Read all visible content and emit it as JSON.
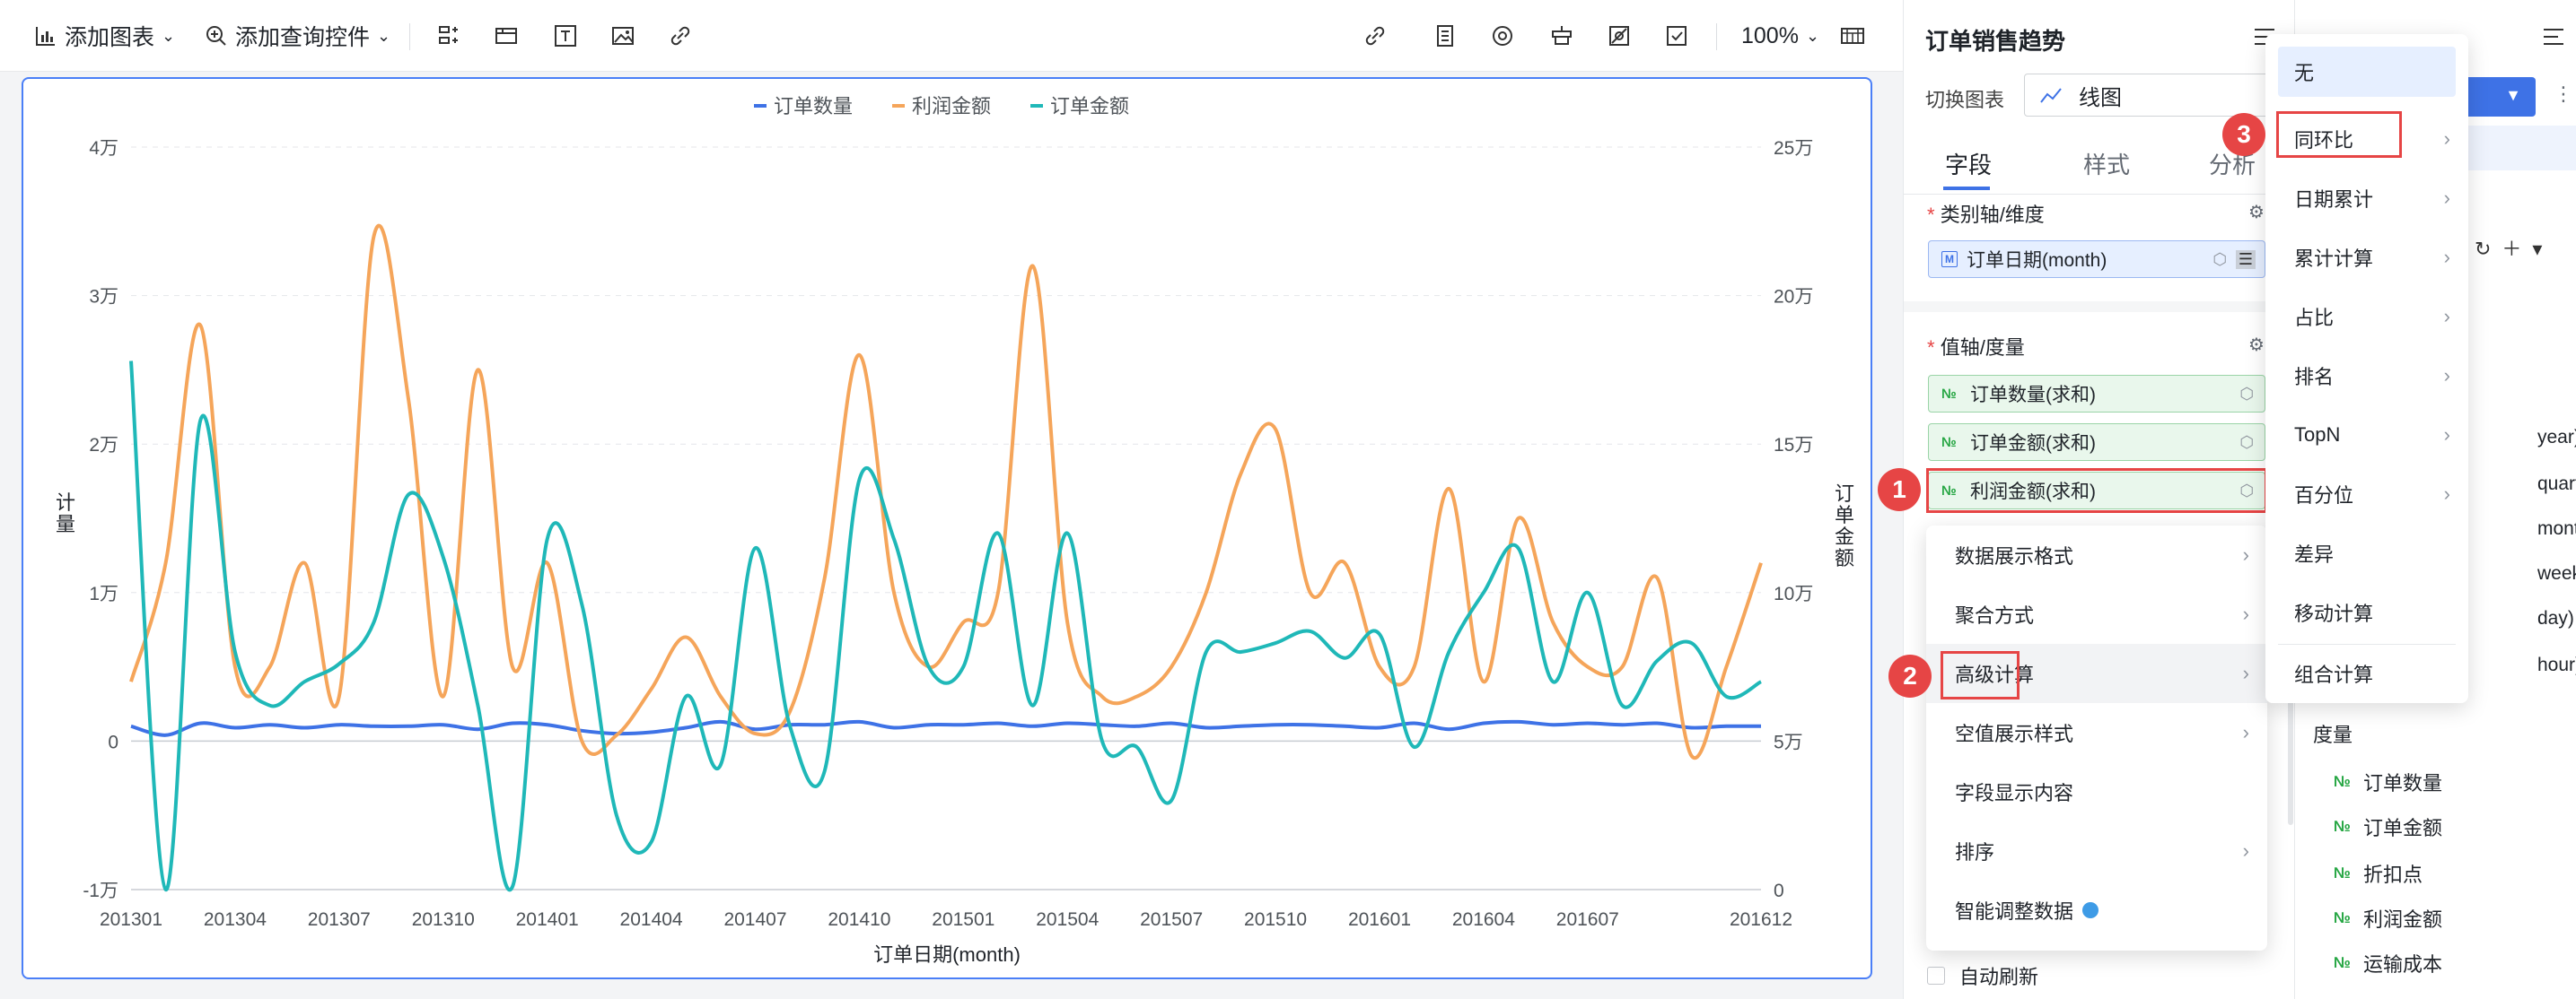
{
  "toolbar": {
    "add_chart": "添加图表",
    "add_control": "添加查询控件",
    "zoom": "100%"
  },
  "chart": {
    "legend": [
      "订单数量",
      "利润金额",
      "订单金额"
    ],
    "y_left_label": "计量",
    "y_right_label": "订单金额",
    "x_label": "订单日期(month)",
    "y_left_ticks": [
      "4万",
      "3万",
      "2万",
      "1万",
      "0",
      "-1万"
    ],
    "y_right_ticks": [
      "25万",
      "20万",
      "15万",
      "10万",
      "5万",
      "0"
    ],
    "x_ticks": [
      "201301",
      "201304",
      "201307",
      "201310",
      "201401",
      "201404",
      "201407",
      "201410",
      "201501",
      "201504",
      "201507",
      "201510",
      "201601",
      "201604",
      "201607",
      "201612"
    ]
  },
  "chart_data": {
    "type": "line",
    "x": [
      "201301",
      "201302",
      "201303",
      "201304",
      "201305",
      "201306",
      "201307",
      "201308",
      "201309",
      "201310",
      "201311",
      "201312",
      "201401",
      "201402",
      "201403",
      "201404",
      "201405",
      "201406",
      "201407",
      "201408",
      "201409",
      "201410",
      "201411",
      "201412",
      "201501",
      "201502",
      "201503",
      "201504",
      "201505",
      "201506",
      "201507",
      "201508",
      "201509",
      "201510",
      "201511",
      "201512",
      "201601",
      "201602",
      "201603",
      "201604",
      "201605",
      "201606",
      "201607",
      "201608",
      "201609",
      "201610",
      "201611",
      "201612"
    ],
    "series": [
      {
        "name": "订单数量",
        "axis": "left",
        "color": "#3e72e6",
        "values": [
          1000,
          400,
          1200,
          900,
          1100,
          900,
          1100,
          1000,
          1000,
          1100,
          800,
          1200,
          1100,
          700,
          500,
          600,
          900,
          1300,
          800,
          1100,
          1100,
          1300,
          900,
          1100,
          1100,
          1200,
          1000,
          1200,
          1100,
          1000,
          1200,
          900,
          1000,
          1100,
          1100,
          1000,
          900,
          1200,
          800,
          1200,
          1300,
          1100,
          1200,
          1100,
          1200,
          900,
          1000,
          1000
        ]
      },
      {
        "name": "利润金额",
        "axis": "left",
        "color": "#f5a55a",
        "values": [
          4000,
          12000,
          28000,
          5000,
          5000,
          12000,
          3000,
          34000,
          23000,
          3000,
          25000,
          5000,
          12000,
          0,
          400,
          3500,
          7000,
          3000,
          500,
          2000,
          11000,
          26000,
          10000,
          5000,
          8000,
          10000,
          32000,
          8000,
          3000,
          3000,
          5000,
          10000,
          18000,
          21000,
          10000,
          12000,
          5000,
          5000,
          17000,
          4000,
          15000,
          8000,
          5000,
          5000,
          11000,
          -1000,
          5000,
          12000
        ]
      },
      {
        "name": "订单金额",
        "axis": "right",
        "color": "#1fb8b8",
        "values": [
          178000,
          0,
          158000,
          80000,
          62000,
          70000,
          76000,
          90000,
          133000,
          112000,
          62000,
          1000,
          118000,
          96000,
          25000,
          16000,
          65000,
          42000,
          115000,
          55000,
          40000,
          138000,
          118000,
          75000,
          75000,
          120000,
          62000,
          120000,
          50000,
          48000,
          30000,
          80000,
          80000,
          83000,
          87000,
          78000,
          86000,
          48000,
          80000,
          100000,
          115000,
          70000,
          100000,
          62000,
          77000,
          83000,
          65000,
          70000
        ]
      }
    ],
    "y_left_range": [
      -10000,
      40000
    ],
    "y_right_range": [
      0,
      250000
    ],
    "xlabel": "订单日期(month)",
    "ylabel_left": "计量",
    "ylabel_right": "订单金额",
    "grid": true,
    "legend_position": "top-center"
  },
  "config": {
    "title": "订单销售趋势",
    "switch_chart_label": "切换图表",
    "switch_chart_value": "线图",
    "tabs": [
      "字段",
      "样式",
      "分析"
    ],
    "dim_title": "类别轴/维度",
    "dim_pill": "订单日期(month)",
    "mea_title": "值轴/度量",
    "mea_pills": [
      "订单数量(求和)",
      "订单金额(求和)",
      "利润金额(求和)"
    ],
    "auto_refresh": "自动刷新"
  },
  "context_menu": {
    "items": [
      "数据展示格式",
      "聚合方式",
      "高级计算",
      "空值展示样式",
      "字段显示内容",
      "排序",
      "智能调整数据"
    ]
  },
  "submenu": {
    "items": [
      "无",
      "同环比",
      "日期累计",
      "累计计算",
      "占比",
      "排名",
      "TopN",
      "百分位",
      "差异",
      "移动计算",
      "组合计算"
    ]
  },
  "fields_panel": {
    "date_parts": [
      "year)",
      "quarter)",
      "month)",
      "week)",
      "day)",
      "hour)"
    ],
    "measure_title": "度量",
    "measures": [
      "订单数量",
      "订单金额",
      "折扣点",
      "利润金额",
      "运输成本"
    ]
  },
  "steps": [
    "1",
    "2",
    "3"
  ]
}
